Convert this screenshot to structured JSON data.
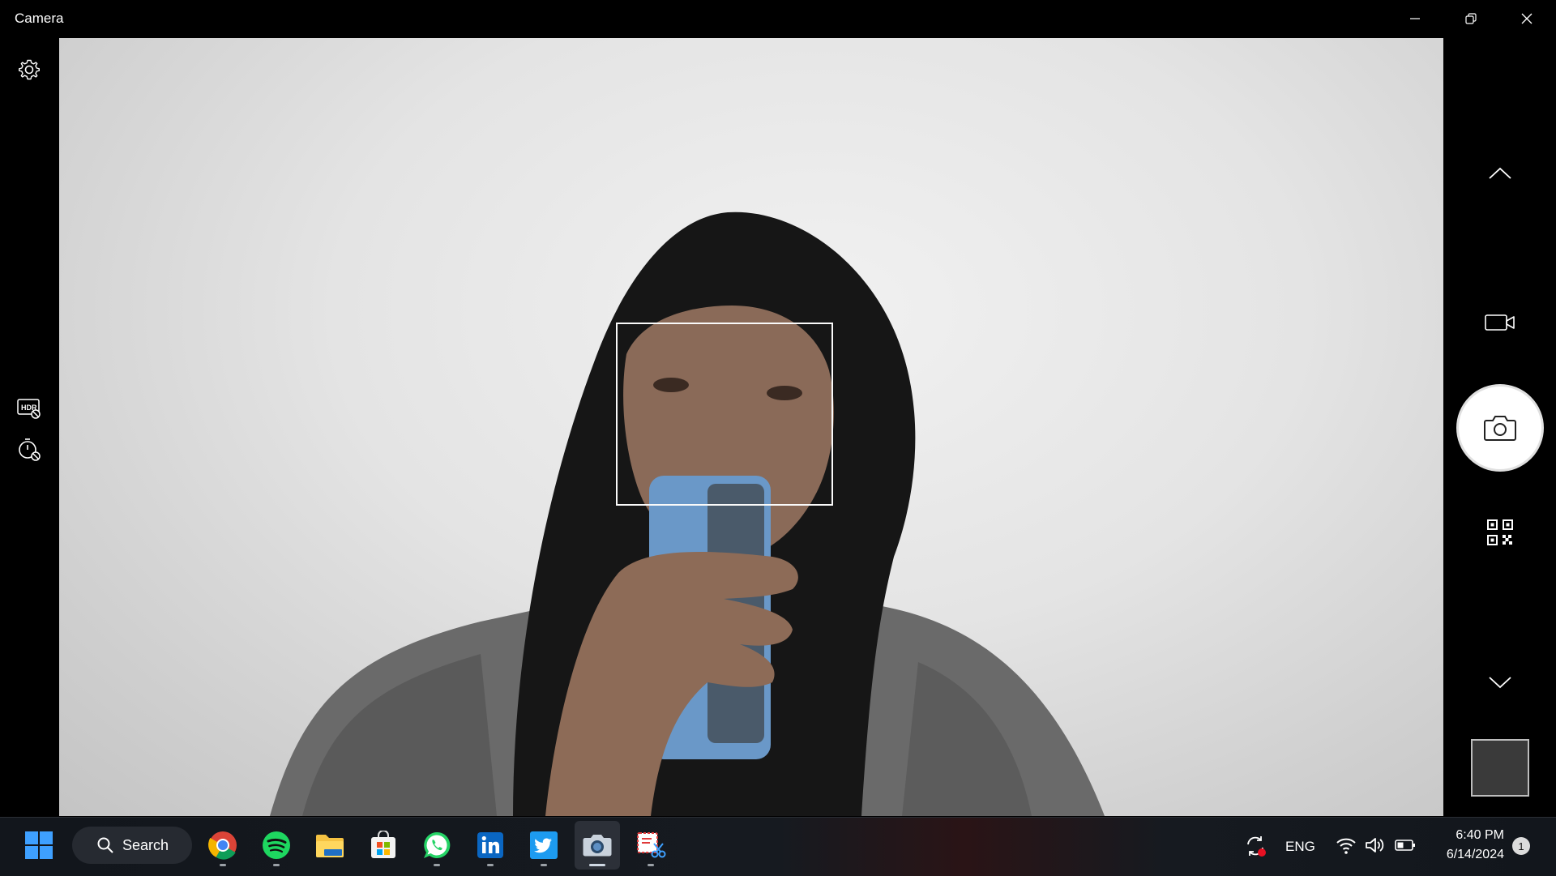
{
  "window": {
    "title": "Camera"
  },
  "viewfinder": {
    "face_detection_box": "face-box"
  },
  "left_controls": {
    "settings_icon": "gear-icon",
    "hdr_icon": "hdr-off-icon",
    "timer_icon": "timer-off-icon"
  },
  "right_controls": {
    "scroll_up_icon": "chevron-up-icon",
    "video_mode_icon": "video-camera-icon",
    "photo_shutter_icon": "camera-icon",
    "barcode_mode_icon": "qr-code-icon",
    "scroll_down_icon": "chevron-down-icon"
  },
  "taskbar": {
    "search_label": "Search",
    "pinned_apps": [
      "Chrome",
      "Spotify",
      "File Explorer",
      "Microsoft Store",
      "WhatsApp",
      "LinkedIn",
      "Twitter",
      "Camera",
      "Snipping Tool"
    ],
    "language": "ENG",
    "time": "6:40 PM",
    "date": "6/14/2024",
    "notification_count": "1"
  },
  "colors": {
    "background": "#000000",
    "taskbar": "#161a20",
    "accent_windows": "#3ea0ff",
    "spotify": "#1ed760",
    "whatsapp": "#25d366",
    "linkedin": "#0a66c2",
    "twitter": "#1d9bf0"
  }
}
